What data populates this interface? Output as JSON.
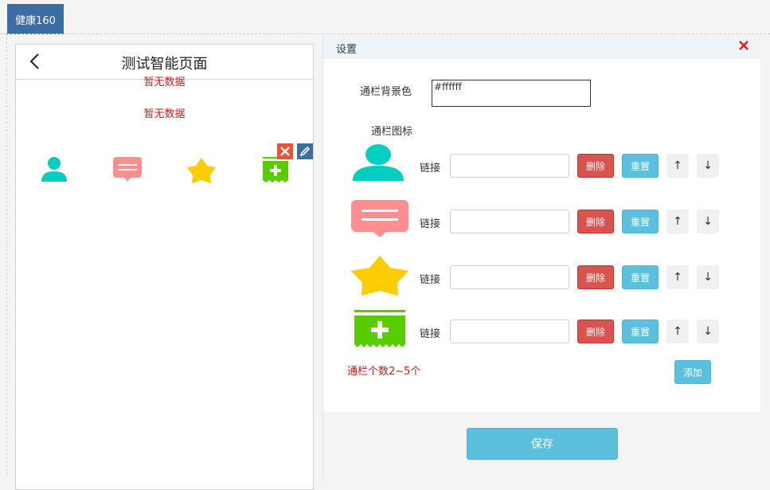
{
  "top_tab": {
    "label": "健康160"
  },
  "phone": {
    "title": "测试智能页面",
    "empty_text_1": "暂无数据",
    "empty_text_2": "暂无数据",
    "nav_icons": [
      "person-icon",
      "message-icon",
      "star-icon",
      "add-ticket-icon"
    ]
  },
  "panel": {
    "title": "设置",
    "bg_color_label": "通栏背景色",
    "bg_color_value": "#ffffff",
    "icons_label": "通栏图标",
    "rows": [
      {
        "icon": "person-icon",
        "link_label": "链接",
        "link_value": "",
        "delete": "删除",
        "reset": "重置",
        "up": "↑",
        "down": "↓"
      },
      {
        "icon": "message-icon",
        "link_label": "链接",
        "link_value": "",
        "delete": "删除",
        "reset": "重置",
        "up": "↑",
        "down": "↓"
      },
      {
        "icon": "star-icon",
        "link_label": "链接",
        "link_value": "",
        "delete": "删除",
        "reset": "重置",
        "up": "↑",
        "down": "↓"
      },
      {
        "icon": "add-ticket-icon",
        "link_label": "链接",
        "link_value": "",
        "delete": "删除",
        "reset": "重置",
        "up": "↑",
        "down": "↓"
      }
    ],
    "hint": "通栏个数2~5个",
    "add_label": "添加",
    "save_label": "保存"
  },
  "colors": {
    "brand_blue": "#3b6ea5",
    "info": "#5bc0de",
    "danger": "#d9534f",
    "teal_icon": "#00cfc0",
    "pink_icon": "#ff8f8f",
    "yellow_icon": "#ffcc00",
    "green_icon": "#59cc00"
  }
}
